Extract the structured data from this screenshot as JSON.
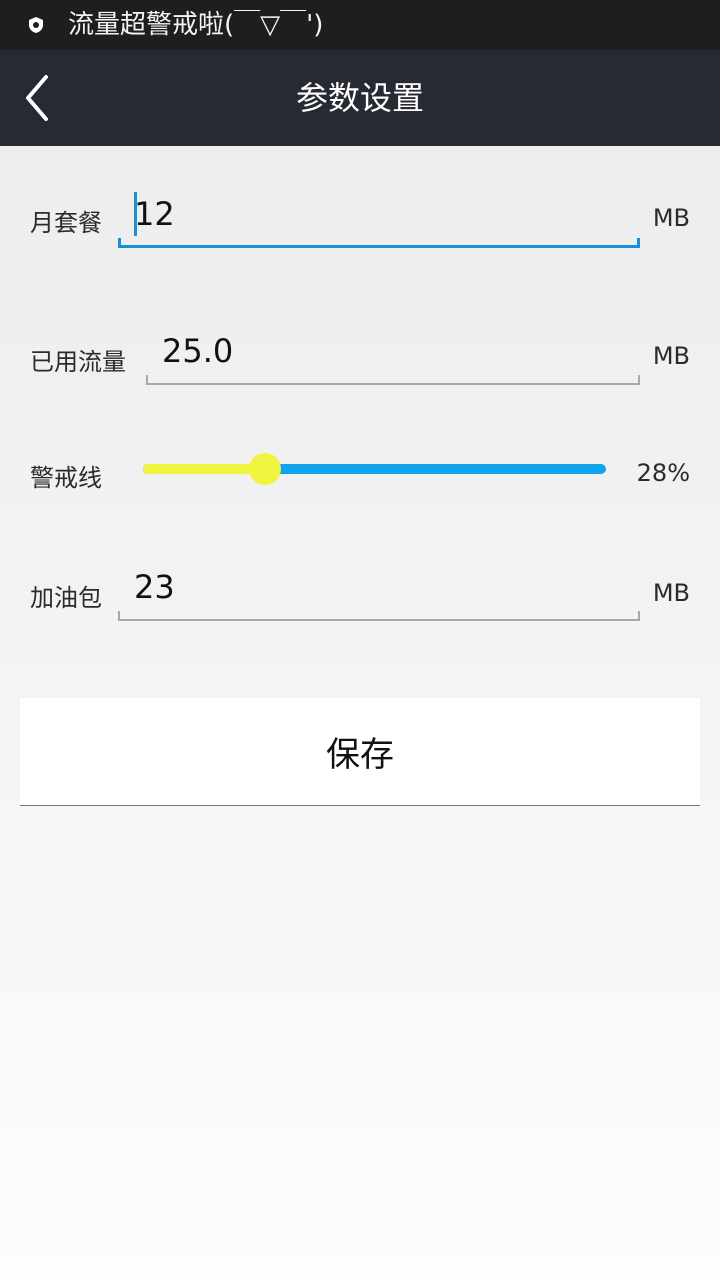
{
  "status_bar": {
    "icon": "shield-icon",
    "notification_text": "流量超警戒啦(￣▽￣')"
  },
  "app_bar": {
    "back_icon": "chevron-left-icon",
    "title": "参数设置"
  },
  "form": {
    "monthly_plan": {
      "label": "月套餐",
      "value": "12",
      "unit": "MB"
    },
    "used_data": {
      "label": "已用流量",
      "value": "25.0",
      "unit": "MB"
    },
    "warning_line": {
      "label": "警戒线",
      "value_percent": 28,
      "value_text": "28%"
    },
    "data_pack": {
      "label": "加油包",
      "value": "23",
      "unit": "MB"
    }
  },
  "save_button": {
    "label": "保存"
  },
  "colors": {
    "status_bar_bg": "#1d1e20",
    "app_bar_bg": "#272a33",
    "accent": "#1a8fd3",
    "slider_fill": "#eff53e",
    "slider_track": "#10a2ec"
  }
}
